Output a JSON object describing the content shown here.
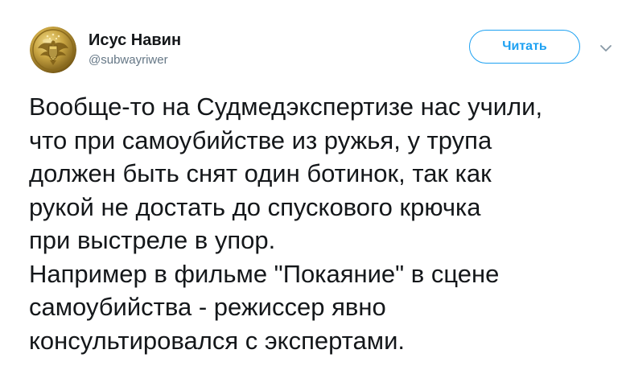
{
  "author": {
    "display_name": "Исус Навин",
    "handle": "@subwayriwer",
    "avatar_icon": "brass-eagle-button-icon"
  },
  "actions": {
    "follow_label": "Читать",
    "menu_icon": "chevron-down-icon"
  },
  "tweet": {
    "lines": [
      "Вообще-то на Судмедэкспертизе нас учили,",
      "что при самоубийстве из ружья, у трупа",
      "должен быть снят один ботинок, так как",
      "рукой не достать до спускового крючка",
      "при выстреле в упор.",
      "Например в фильме \"Покаяние\" в сцене",
      "самоубийства - режиссер явно",
      "консультировался с экспертами."
    ]
  },
  "colors": {
    "accent": "#1da1f2",
    "text": "#14171a",
    "secondary_text": "#657786"
  }
}
